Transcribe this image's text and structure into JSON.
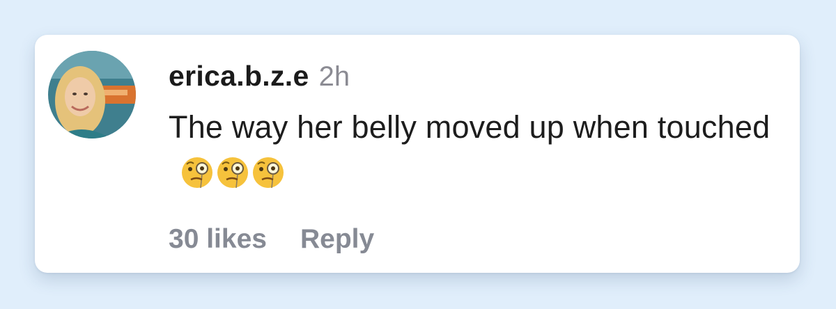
{
  "comment": {
    "username": "erica.b.z.e",
    "timestamp": "2h",
    "text": "The way her belly moved up when touched",
    "emojis": [
      "face-with-monocle",
      "face-with-monocle",
      "face-with-monocle"
    ],
    "avatar": "profile-photo"
  },
  "actions": {
    "likes_label": "30 likes",
    "reply_label": "Reply"
  },
  "colors": {
    "background": "#e0eefb",
    "card": "#ffffff",
    "text": "#1d1d1d",
    "muted": "#868a94"
  }
}
